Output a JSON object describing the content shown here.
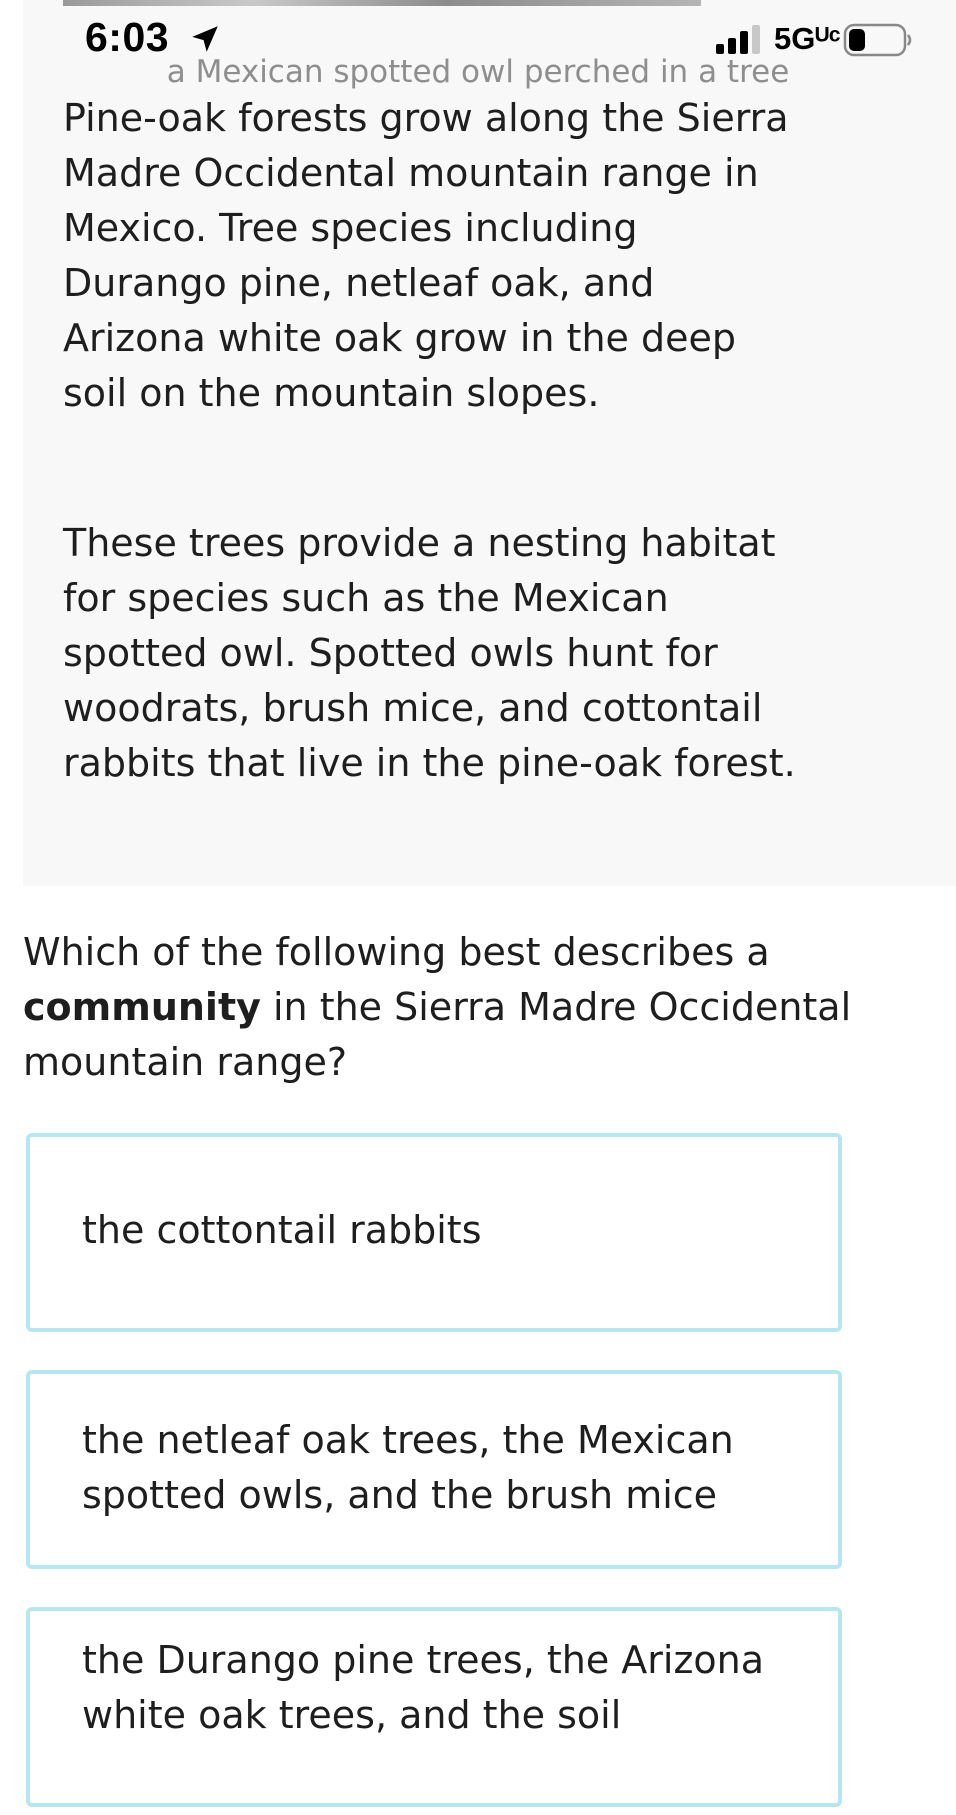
{
  "status_bar": {
    "time": "6:03",
    "network": "5Gᵁᶜ",
    "icons": [
      "location-arrow-icon",
      "signal-bars-icon",
      "battery-icon"
    ]
  },
  "passage": {
    "image_caption": "a Mexican spotted owl perched in a tree",
    "paragraphs": [
      "Pine-oak forests grow along the Sierra Madre Occidental mountain range in Mexico. Tree species including Durango pine, netleaf oak, and Arizona white oak grow in the deep soil on the mountain slopes.",
      "These trees provide a nesting habitat for species such as the Mexican spotted owl. Spotted owls hunt for woodrats, brush mice, and cottontail rabbits that live in the pine-oak forest."
    ]
  },
  "question": {
    "prefix": "Which of the following best describes a ",
    "bold_term": "community",
    "suffix": " in the Sierra Madre Occidental mountain range?"
  },
  "choices": [
    {
      "label": "the cottontail rabbits"
    },
    {
      "label": "the netleaf oak trees, the Mexican spotted owls, and the brush mice"
    },
    {
      "label": "the Durango pine trees, the Arizona white oak trees, and the soil"
    }
  ],
  "colors": {
    "panel_background": "#f8f8f8",
    "choice_border": "#b6e6f1",
    "caption_text": "#8e8e8e",
    "body_text": "#1e1e1e"
  }
}
